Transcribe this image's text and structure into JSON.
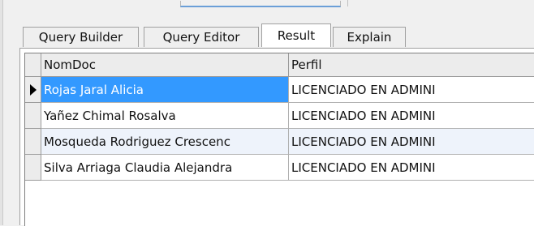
{
  "tabs": [
    {
      "label": "Query Builder",
      "active": false
    },
    {
      "label": "Query Editor",
      "active": false
    },
    {
      "label": "Result",
      "active": true
    },
    {
      "label": "Explain",
      "active": false
    }
  ],
  "grid": {
    "columns": [
      "NomDoc",
      "Perfil"
    ],
    "rows": [
      {
        "NomDoc": "Rojas Jaral Alicia",
        "Perfil": "LICENCIADO EN ADMINI",
        "selected": true
      },
      {
        "NomDoc": "Yañez Chimal Rosalva",
        "Perfil": "LICENCIADO EN ADMINI",
        "selected": false
      },
      {
        "NomDoc": "Mosqueda Rodriguez Crescenc",
        "Perfil": "LICENCIADO EN ADMINI",
        "selected": false
      },
      {
        "NomDoc": "Silva Arriaga Claudia Alejandra",
        "Perfil": "LICENCIADO EN ADMINI",
        "selected": false
      }
    ]
  },
  "colors": {
    "selection": "#3399ff",
    "alt_row": "#eef3fb",
    "header_bg": "#ececec"
  },
  "icons": {
    "current_row_indicator": "row-pointer-icon"
  }
}
